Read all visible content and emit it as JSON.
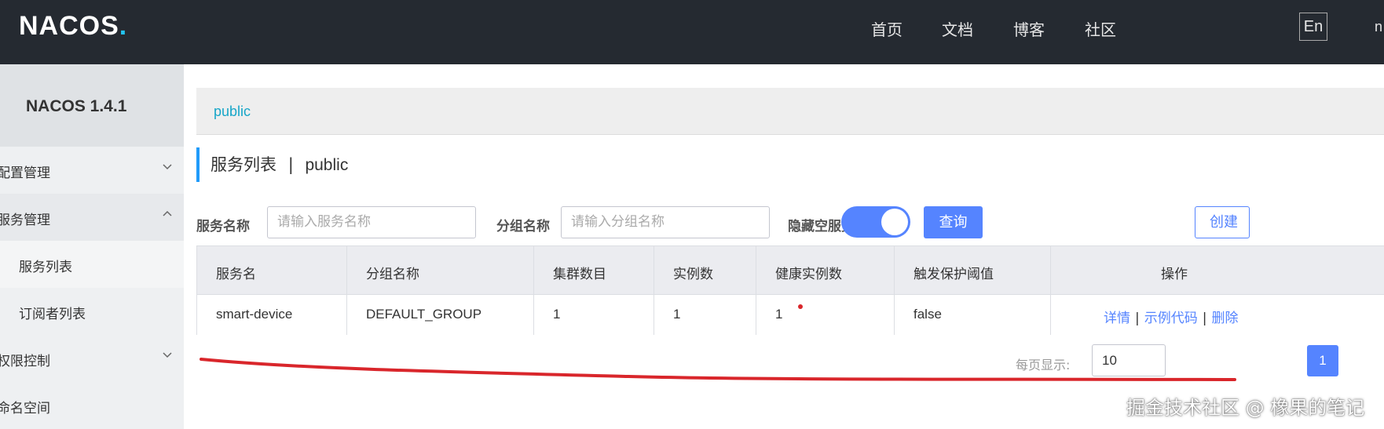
{
  "header": {
    "logo": "NACOS",
    "logo_dot": ".",
    "nav": [
      "首页",
      "文档",
      "博客",
      "社区"
    ],
    "lang_button": "En",
    "user_truncated": "n"
  },
  "sidebar": {
    "version": "NACOS 1.4.1",
    "items": [
      {
        "label": "配置管理",
        "chevron": "down"
      },
      {
        "label": "服务管理",
        "chevron": "up"
      },
      {
        "label": "服务列表"
      },
      {
        "label": "订阅者列表"
      },
      {
        "label": "权限控制",
        "chevron": "down"
      },
      {
        "label": "命名空间"
      }
    ]
  },
  "main": {
    "breadcrumb": "public",
    "title": "服务列表",
    "title_sep": "|",
    "title_ns": "public",
    "filters": {
      "service_label": "服务名称",
      "service_placeholder": "请输入服务名称",
      "group_label": "分组名称",
      "group_placeholder": "请输入分组名称",
      "hide_empty_label": "隐藏空服务:",
      "hide_empty_on": true,
      "query_button": "查询",
      "create_button": "创建"
    },
    "table": {
      "headers": [
        "服务名",
        "分组名称",
        "集群数目",
        "实例数",
        "健康实例数",
        "触发保护阈值",
        "操作"
      ],
      "rows": [
        {
          "name": "smart-device",
          "group": "DEFAULT_GROUP",
          "clusters": "1",
          "instances": "1",
          "healthy": "1",
          "threshold": "false",
          "ops": [
            "详情",
            "示例代码",
            "删除"
          ]
        }
      ]
    },
    "pager": {
      "label": "每页显示:",
      "page_size": "10",
      "current_page": "1"
    }
  },
  "watermark": "掘金技术社区 @ 橡果的笔记",
  "colors": {
    "topbar": "#252a31",
    "accent": "#5584ff",
    "crumb": "#17a6c8",
    "annotation": "#d9262b"
  }
}
